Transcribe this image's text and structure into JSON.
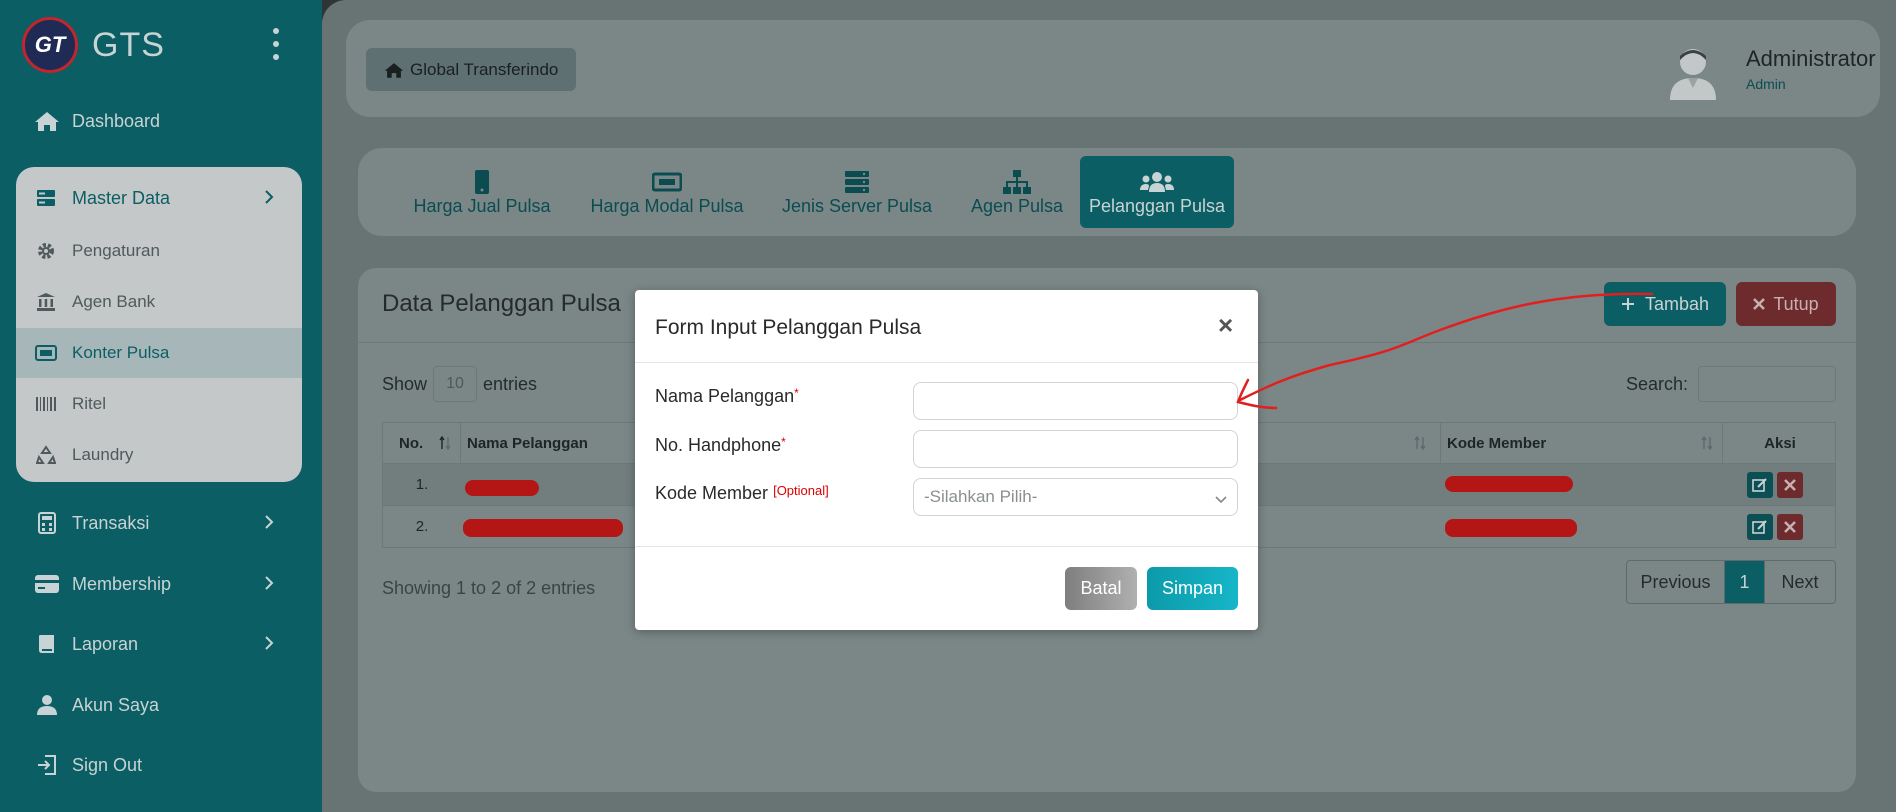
{
  "brand": {
    "name": "GTS",
    "logo_text": "GT"
  },
  "sidebar": {
    "items": [
      {
        "label": "Dashboard",
        "icon": "home-icon"
      },
      {
        "label": "Transaksi",
        "icon": "calculator-icon"
      },
      {
        "label": "Membership",
        "icon": "card-icon"
      },
      {
        "label": "Laporan",
        "icon": "book-icon"
      },
      {
        "label": "Akun Saya",
        "icon": "user-icon"
      },
      {
        "label": "Sign Out",
        "icon": "sign-out-icon"
      }
    ],
    "master": {
      "label": "Master Data",
      "items": [
        {
          "label": "Pengaturan",
          "icon": "gear-icon"
        },
        {
          "label": "Agen Bank",
          "icon": "bank-icon"
        },
        {
          "label": "Konter Pulsa",
          "icon": "ticket-icon"
        },
        {
          "label": "Ritel",
          "icon": "barcode-icon"
        },
        {
          "label": "Laundry",
          "icon": "recycle-icon"
        }
      ]
    }
  },
  "header": {
    "home_label": "Global Transferindo",
    "user_name": "Administrator",
    "user_role": "Admin"
  },
  "tabs": [
    {
      "label": "Harga Jual Pulsa",
      "icon": "mobile-icon"
    },
    {
      "label": "Harga Modal Pulsa",
      "icon": "ticket-icon"
    },
    {
      "label": "Jenis Server Pulsa",
      "icon": "server-icon"
    },
    {
      "label": "Agen Pulsa",
      "icon": "sitemap-icon"
    },
    {
      "label": "Pelanggan Pulsa",
      "icon": "users-icon"
    }
  ],
  "panel": {
    "title": "Data Pelanggan Pulsa",
    "add_label": "Tambah",
    "close_label": "Tutup",
    "show_label": "Show",
    "entries_value": "10",
    "entries_label": "entries",
    "search_label": "Search:",
    "columns": [
      "No.",
      "Nama Pelanggan",
      "Kode Member",
      "Aksi"
    ],
    "rows": [
      {
        "no": "1."
      },
      {
        "no": "2."
      }
    ],
    "showing_text": "Showing 1 to 2 of 2 entries",
    "pagination": {
      "previous": "Previous",
      "current": "1",
      "next": "Next"
    }
  },
  "modal": {
    "title": "Form Input Pelanggan Pulsa",
    "close_symbol": "×",
    "fields": {
      "nama_label": "Nama Pelanggan",
      "hp_label": "No. Handphone",
      "kode_label": "Kode Member",
      "required_mark": "*",
      "optional_mark": "[Optional]",
      "kode_placeholder": "-Silahkan Pilih-"
    },
    "cancel_label": "Batal",
    "save_label": "Simpan"
  },
  "colors": {
    "sidebar": "#0b5e63",
    "accent": "#16b6c8",
    "danger": "#6e2b2e",
    "annotation": "#e0201e"
  }
}
